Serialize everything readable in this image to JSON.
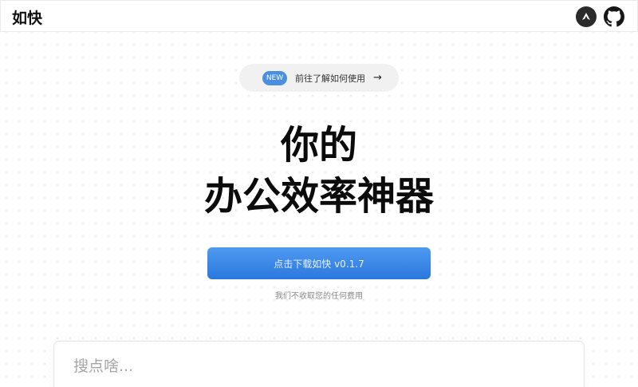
{
  "header": {
    "brand": "如快",
    "icons": [
      "app-logo-icon",
      "github-icon"
    ]
  },
  "announcement": {
    "badge": "NEW",
    "text": "前往了解如何使用",
    "arrow": "→"
  },
  "hero": {
    "line1": "你的",
    "line2": "办公效率神器"
  },
  "download": {
    "label": "点击下载如快 v0.1.7",
    "note": "我们不收取您的任何费用"
  },
  "search": {
    "placeholder": "搜点啥..."
  },
  "colors": {
    "accent": "#2f80ed",
    "badge": "#4a8fe0"
  }
}
